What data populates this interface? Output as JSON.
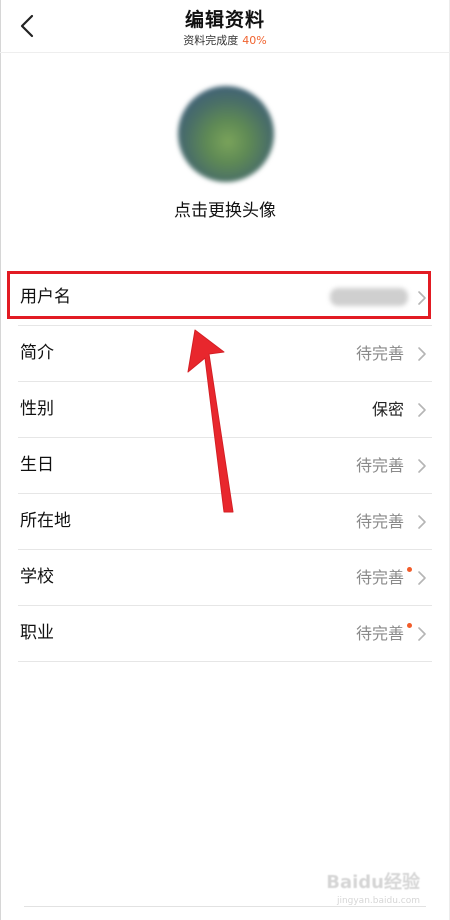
{
  "header": {
    "title": "编辑资料",
    "subtitle_prefix": "资料完成度",
    "completion": "40%"
  },
  "avatar": {
    "label": "点击更换头像"
  },
  "rows": [
    {
      "label": "用户名",
      "value": "",
      "blurred": true
    },
    {
      "label": "简介",
      "value": "待完善"
    },
    {
      "label": "性别",
      "value": "保密"
    },
    {
      "label": "生日",
      "value": "待完善"
    },
    {
      "label": "所在地",
      "value": "待完善"
    },
    {
      "label": "学校",
      "value": "待完善",
      "dot": true
    },
    {
      "label": "职业",
      "value": "待完善",
      "dot": true
    }
  ],
  "watermark": {
    "brand": "Baidu经验",
    "url": "jingyan.baidu.com"
  },
  "colors": {
    "accent": "#f0632f",
    "highlight": "#e21b23",
    "dot": "#f25c2a"
  },
  "icons": {
    "back": "chevron-left-icon",
    "row_arrow": "chevron-right-icon"
  }
}
